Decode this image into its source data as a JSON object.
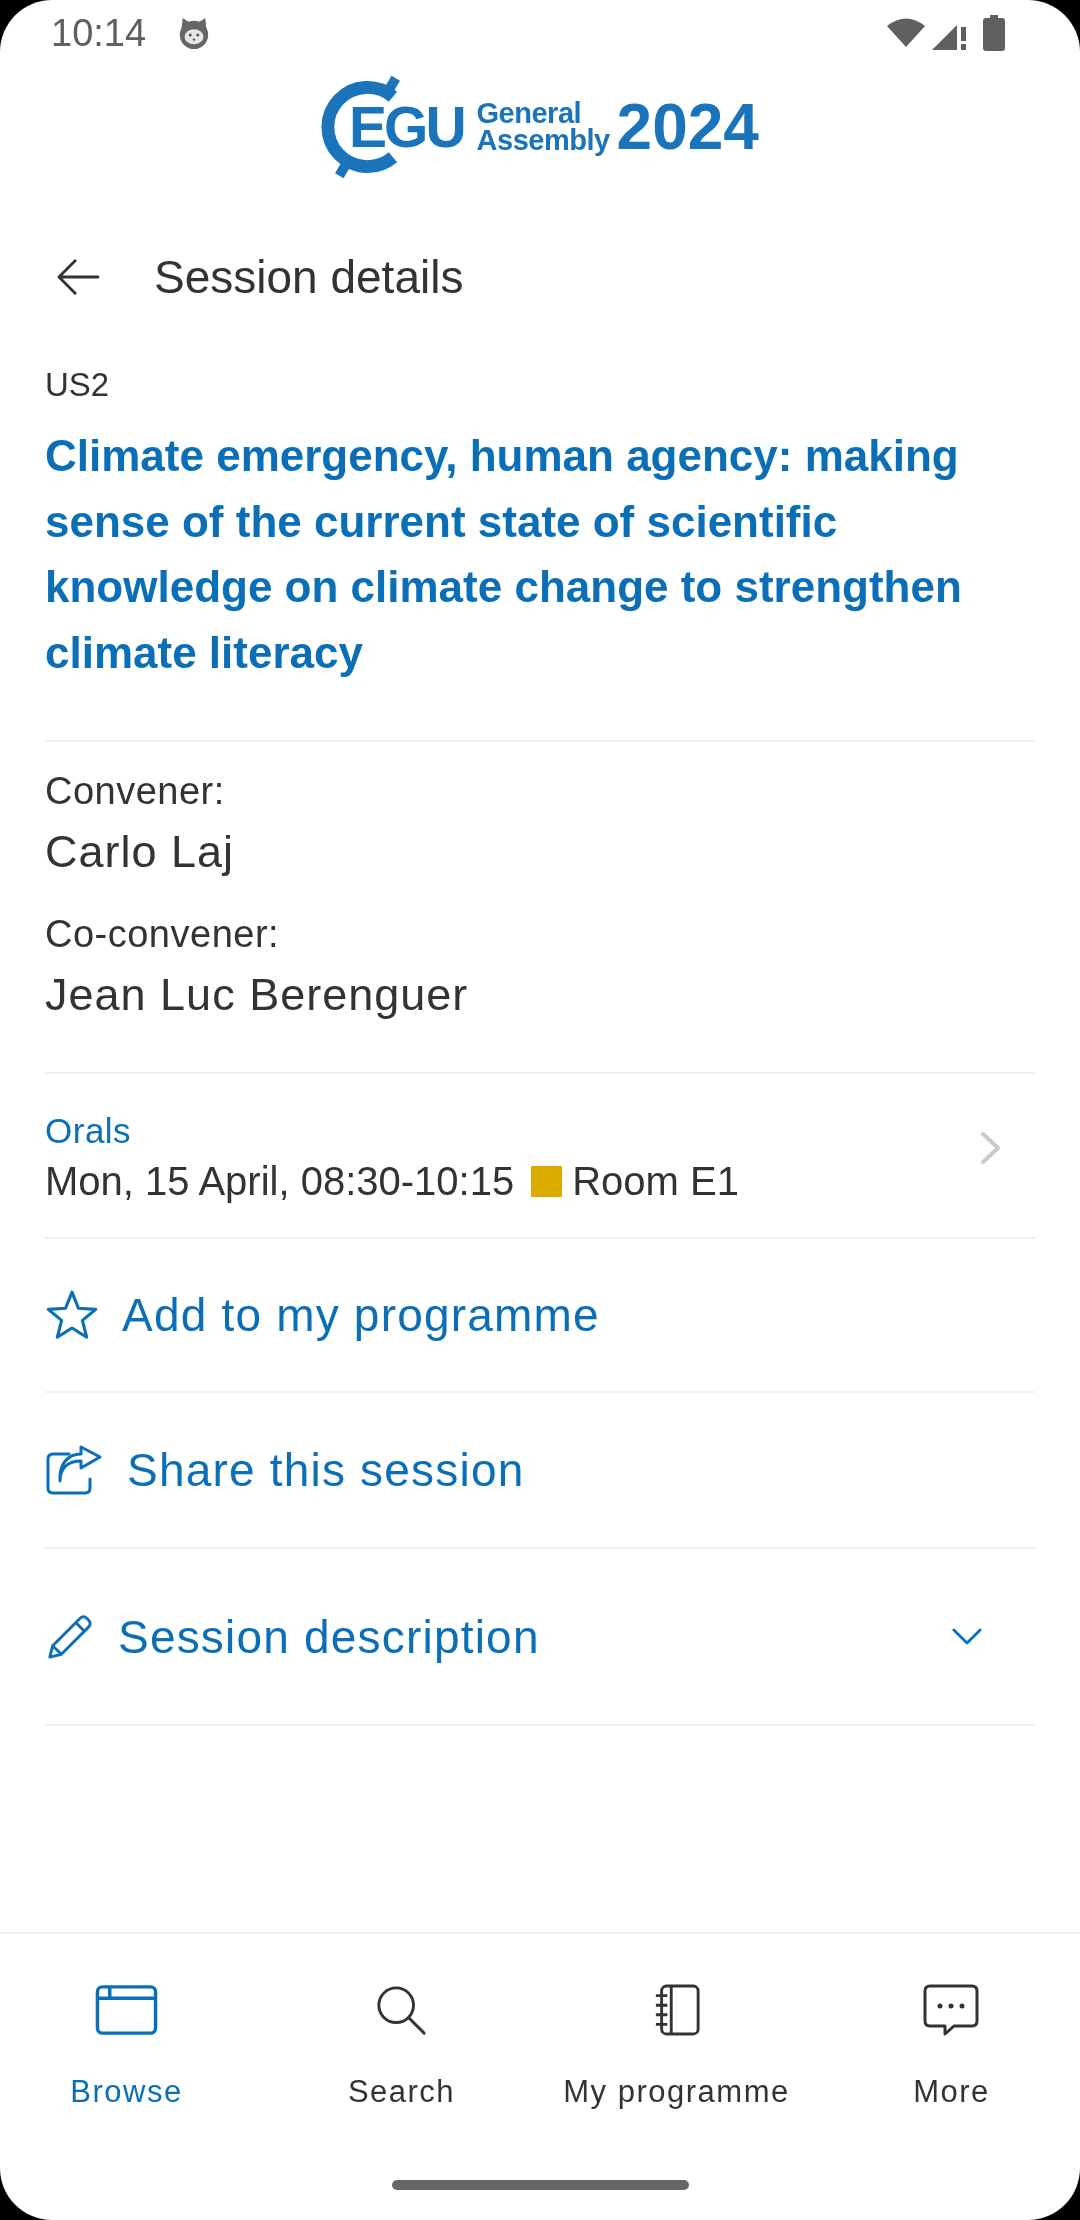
{
  "status_bar": {
    "time": "10:14"
  },
  "logo": {
    "mark": "EGU",
    "line_1": "General",
    "line_2": "Assembly",
    "year": "2024"
  },
  "header": {
    "title": "Session details"
  },
  "session": {
    "code": "US2",
    "title": "Climate emergency, human agency: making sense of the current state of scientific knowledge on climate change to strengthen climate literacy"
  },
  "people": [
    {
      "role": "Convener:",
      "name": "Carlo Laj"
    },
    {
      "role": "Co-convener:",
      "name": "Jean Luc Berenguer"
    }
  ],
  "slot": {
    "type": "Orals",
    "when": "Mon, 15 April, 08:30-10:15",
    "room": "Room E1",
    "color": "#dcab00"
  },
  "actions": [
    {
      "kind": "favorite",
      "label": "Add to my programme"
    },
    {
      "kind": "share",
      "label": "Share this session"
    },
    {
      "kind": "description",
      "label": "Session description",
      "expanded": false
    }
  ],
  "nav": [
    {
      "kind": "browse",
      "label": "Browse",
      "selected": true
    },
    {
      "kind": "search",
      "label": "Search",
      "selected": false
    },
    {
      "kind": "programme",
      "label": "My programme",
      "selected": false
    },
    {
      "kind": "more",
      "label": "More",
      "selected": false
    }
  ]
}
